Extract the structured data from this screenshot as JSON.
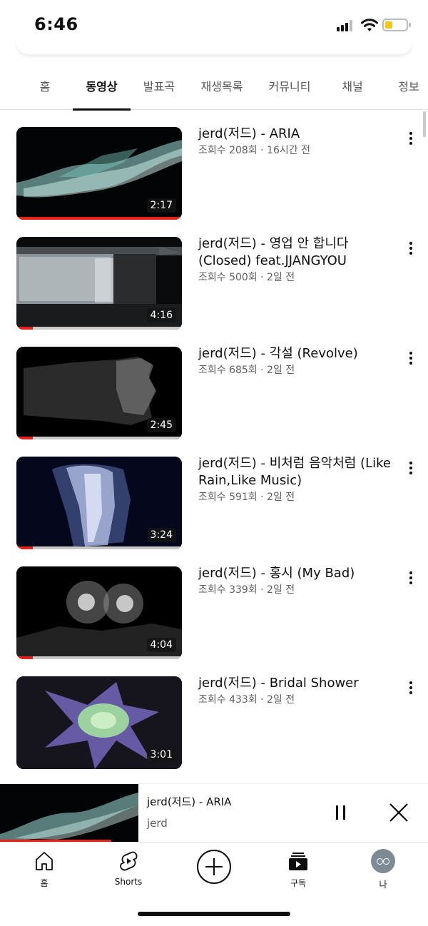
{
  "status_bar": {
    "time": "6:46",
    "icons": [
      "cellular-signal-icon",
      "wifi-icon",
      "battery-icon"
    ],
    "battery_color": "#f5c518"
  },
  "tabs": [
    {
      "label": "홈",
      "active": false
    },
    {
      "label": "동영상",
      "active": true
    },
    {
      "label": "발표곡",
      "active": false
    },
    {
      "label": "재생목록",
      "active": false
    },
    {
      "label": "커뮤니티",
      "active": false
    },
    {
      "label": "채널",
      "active": false
    },
    {
      "label": "정보",
      "active": false
    }
  ],
  "videos": [
    {
      "title": "jerd(저드) - ARIA",
      "meta": "조회수 208회 · 16시간 전",
      "duration": "2:17",
      "watched_fraction": 1.0
    },
    {
      "title": "jerd(저드) - 영업 안 합니다 (Closed) feat.JJANGYOU",
      "meta": "조회수 500회 · 2일 전",
      "duration": "4:16",
      "watched_fraction": 0.1
    },
    {
      "title": "jerd(저드) - 각설 (Revolve)",
      "meta": "조회수 685회 · 2일 전",
      "duration": "2:45",
      "watched_fraction": 0.1
    },
    {
      "title": "jerd(저드) - 비처럼 음악처럼 (Like Rain,Like Music)",
      "meta": "조회수 591회 · 2일 전",
      "duration": "3:24",
      "watched_fraction": 0.1
    },
    {
      "title": "jerd(저드) - 홍시 (My Bad)",
      "meta": "조회수 339회 · 2일 전",
      "duration": "4:04",
      "watched_fraction": 0.1
    },
    {
      "title": "jerd(저드) - Bridal Shower",
      "meta": "조회수 433회 · 2일 전",
      "duration": "3:01",
      "watched_fraction": 0
    }
  ],
  "mini_player": {
    "title": "jerd(저드) - ARIA",
    "channel": "jerd",
    "progress_fraction": 0.8,
    "accent_color": "#e62117"
  },
  "bottom_nav": {
    "home": "홈",
    "shorts": "Shorts",
    "subscriptions": "구독",
    "me": "나"
  }
}
